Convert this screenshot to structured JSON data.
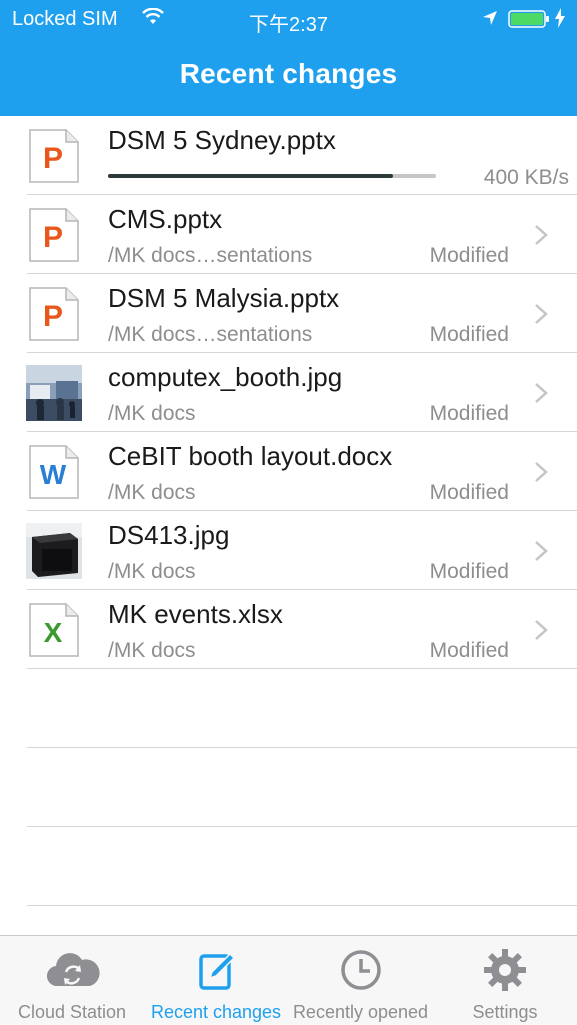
{
  "status_bar": {
    "carrier": "Locked SIM",
    "time": "下午2:37"
  },
  "nav": {
    "title": "Recent changes"
  },
  "uploading": {
    "name": "DSM 5 Sydney.pptx",
    "speed": "400 KB/s",
    "progress": 0.87,
    "icon": "powerpoint-icon"
  },
  "files": [
    {
      "name": "CMS.pptx",
      "path": "/MK docs…sentations",
      "status": "Modified",
      "icon": "powerpoint-icon"
    },
    {
      "name": "DSM 5 Malysia.pptx",
      "path": "/MK docs…sentations",
      "status": "Modified",
      "icon": "powerpoint-icon"
    },
    {
      "name": "computex_booth.jpg",
      "path": "/MK docs",
      "status": "Modified",
      "icon": "photo-thumbnail-booth"
    },
    {
      "name": "CeBIT booth layout.docx",
      "path": "/MK docs",
      "status": "Modified",
      "icon": "word-icon"
    },
    {
      "name": "DS413.jpg",
      "path": "/MK docs",
      "status": "Modified",
      "icon": "photo-thumbnail-device"
    },
    {
      "name": "MK events.xlsx",
      "path": "/MK docs",
      "status": "Modified",
      "icon": "excel-icon"
    }
  ],
  "tabs": [
    {
      "label": "Cloud Station",
      "icon": "cloud-sync-icon",
      "active": false
    },
    {
      "label": "Recent changes",
      "icon": "edit-icon",
      "active": true
    },
    {
      "label": "Recently opened",
      "icon": "clock-icon",
      "active": false
    },
    {
      "label": "Settings",
      "icon": "gear-icon",
      "active": false
    }
  ],
  "colors": {
    "accent": "#1ea0ef",
    "powerpoint": "#e8581c",
    "word": "#2a7fd4",
    "excel": "#3a9a2e"
  }
}
